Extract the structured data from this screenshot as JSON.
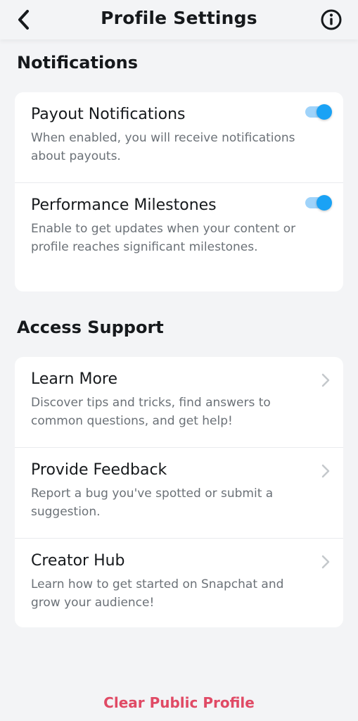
{
  "header": {
    "title": "Profile Settings",
    "back_icon": "chevron-left-icon",
    "info_icon": "info-circle-icon"
  },
  "notifications": {
    "section_title": "Notifications",
    "items": [
      {
        "title": "Payout Notifications",
        "description": "When enabled, you will receive notifications about payouts.",
        "enabled": true
      },
      {
        "title": "Performance Milestones",
        "description": "Enable to get updates when your content or profile reaches significant milestones.",
        "enabled": true
      }
    ]
  },
  "support": {
    "section_title": "Access Support",
    "items": [
      {
        "title": "Learn More",
        "description": "Discover tips and tricks, find answers to common questions, and get help!"
      },
      {
        "title": "Provide Feedback",
        "description": "Report a bug you've spotted or submit a suggestion."
      },
      {
        "title": "Creator Hub",
        "description": "Learn how to get started on Snapchat and grow your audience!"
      }
    ]
  },
  "footer": {
    "clear_label": "Clear Public Profile"
  },
  "colors": {
    "accent": "#1aa2f5",
    "danger": "#e04a65",
    "background": "#f3f4f6"
  }
}
